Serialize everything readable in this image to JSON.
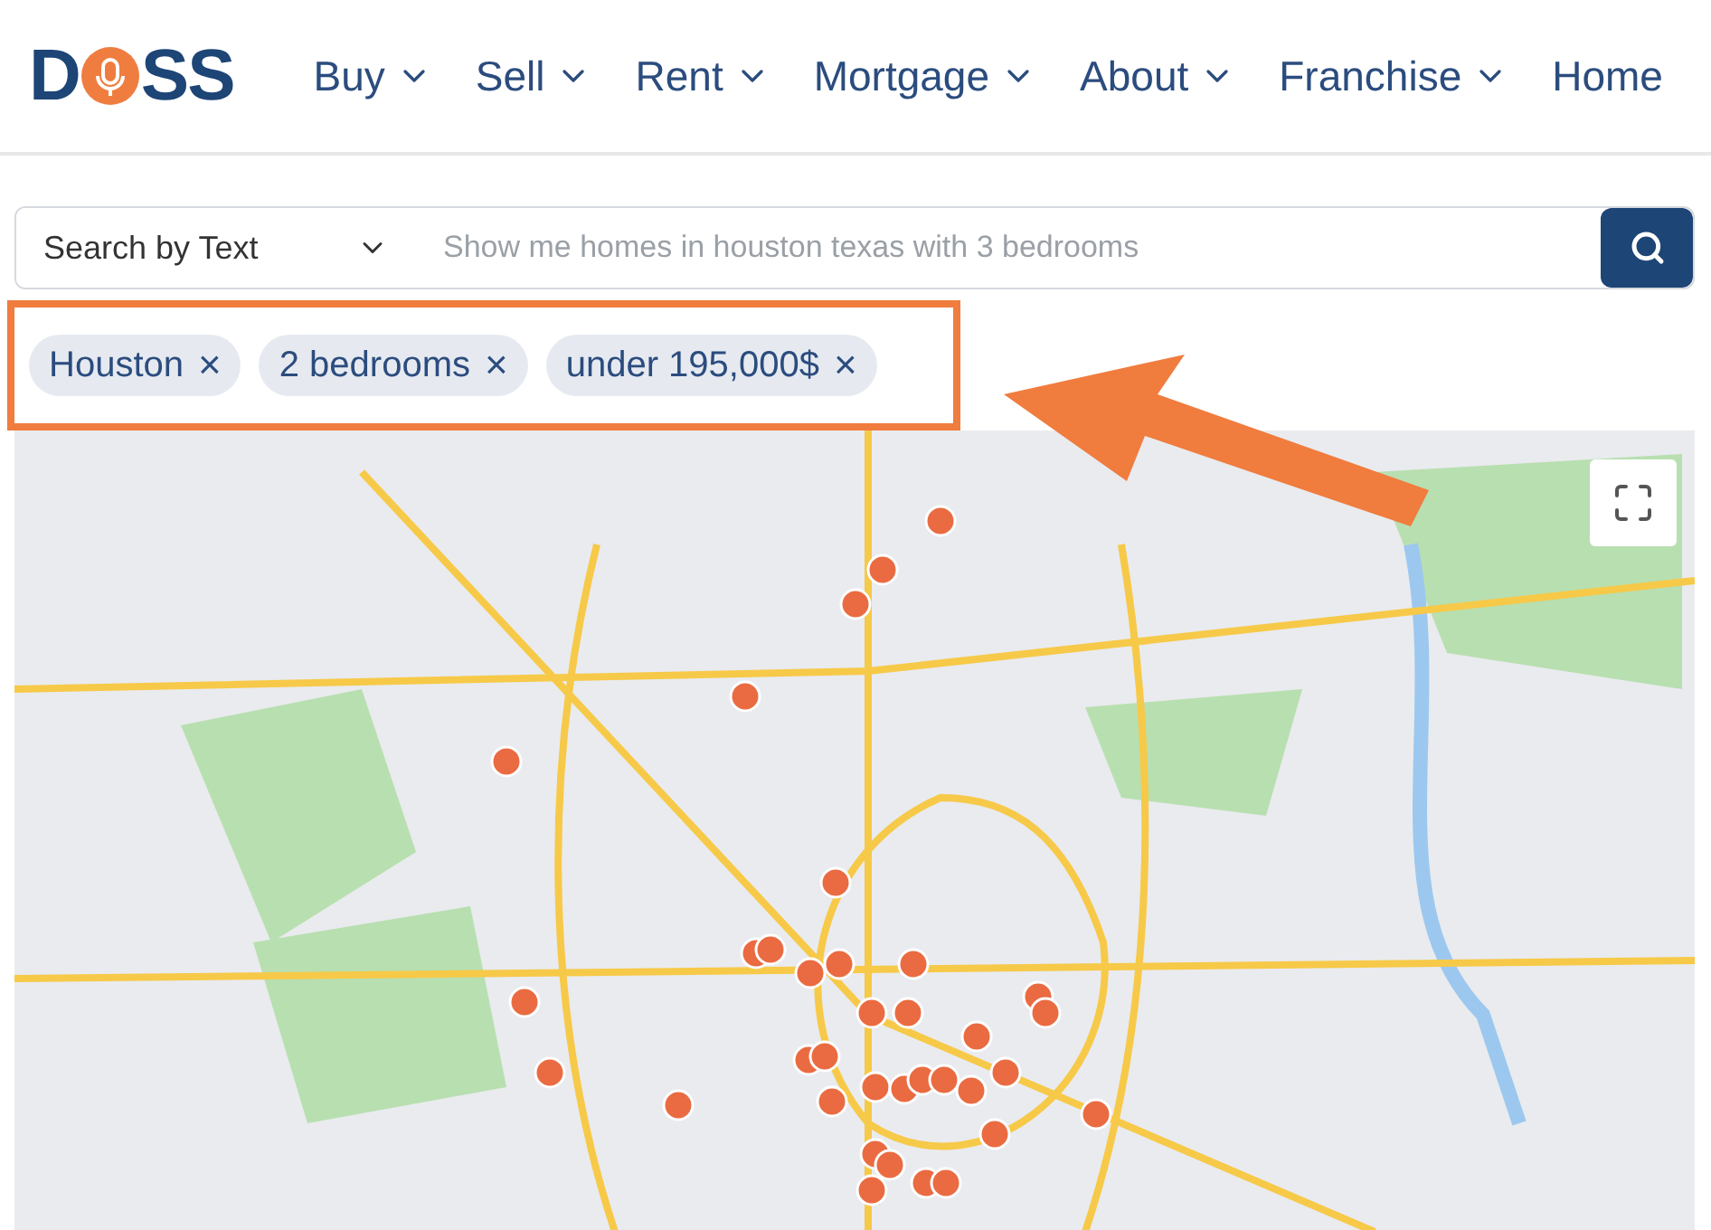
{
  "logo": {
    "before": "D",
    "after": "SS"
  },
  "nav": [
    {
      "label": "Buy",
      "dropdown": true
    },
    {
      "label": "Sell",
      "dropdown": true
    },
    {
      "label": "Rent",
      "dropdown": true
    },
    {
      "label": "Mortgage",
      "dropdown": true
    },
    {
      "label": "About",
      "dropdown": true
    },
    {
      "label": "Franchise",
      "dropdown": true
    },
    {
      "label": "Home",
      "dropdown": false
    }
  ],
  "search": {
    "mode": "Search by Text",
    "placeholder": "Show me homes in houston texas with 3 bedrooms"
  },
  "filters": [
    {
      "label": "Houston",
      "remove": "×"
    },
    {
      "label": "2 bedrooms",
      "remove": "×"
    },
    {
      "label": "under 195,000$",
      "remove": "×"
    }
  ],
  "highlight": {
    "shown": true,
    "color": "#f07c3e"
  }
}
